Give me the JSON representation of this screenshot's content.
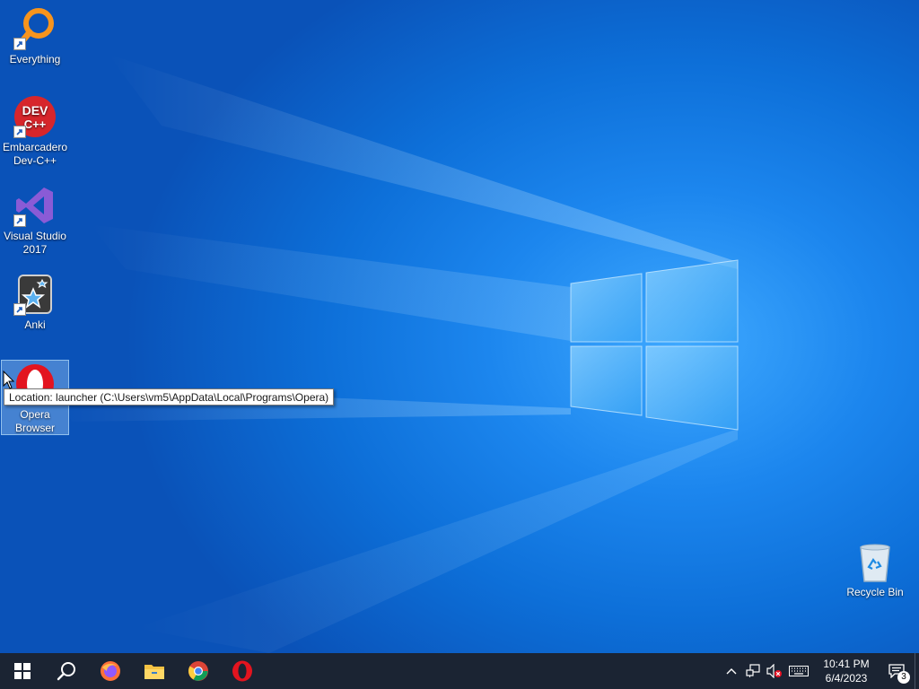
{
  "desktop": {
    "icons": [
      {
        "label_lines": [
          "Everything"
        ]
      },
      {
        "label_lines": [
          "Embarcadero",
          "Dev-C++"
        ],
        "logo_text": [
          "DEV",
          "C++"
        ]
      },
      {
        "label_lines": [
          "Visual Studio",
          "2017"
        ]
      },
      {
        "label_lines": [
          "Anki"
        ]
      },
      {
        "label_lines": [
          "Opera",
          "Browser"
        ]
      }
    ],
    "recycle_bin": {
      "label": "Recycle Bin"
    },
    "tooltip": "Location: launcher (C:\\Users\\vm5\\AppData\\Local\\Programs\\Opera)"
  },
  "taskbar": {
    "buttons": [
      "start-icon",
      "search-icon",
      "firefox-icon",
      "file-explorer-icon",
      "chrome-icon",
      "opera-icon"
    ],
    "tray": {
      "icons": [
        "chevron-up-icon",
        "network-icon",
        "volume-muted-icon",
        "keyboard-icon"
      ],
      "time": "10:41 PM",
      "date": "6/4/2023",
      "notification_count": "3"
    }
  },
  "colors": {
    "taskbar": "#1b2433",
    "wallpaper_center": "#3fa9ff",
    "wallpaper_edge": "#0a52b8",
    "tooltip_bg": "#ffffff"
  }
}
